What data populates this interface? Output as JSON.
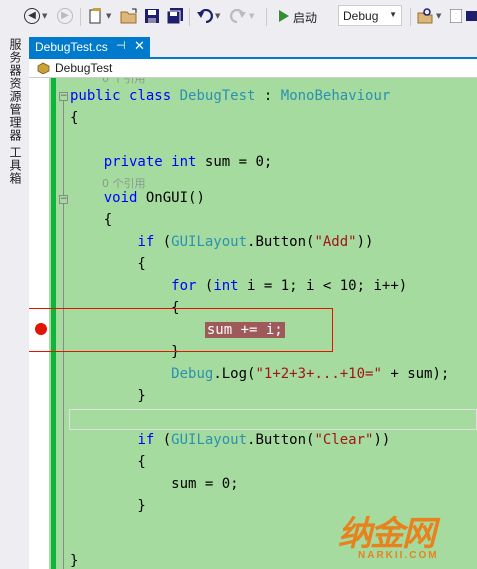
{
  "toolbar": {
    "start_label": "启动",
    "config_value": "Debug"
  },
  "left_strip": {
    "tabs": [
      "服务器资源管理器",
      "工具箱"
    ]
  },
  "document_tab": {
    "title": "DebugTest.cs",
    "pin_glyph": "⊣",
    "close_glyph": "✕"
  },
  "navbar": {
    "class_dropdown": "DebugTest"
  },
  "editor": {
    "codelens_top": "0 个引用",
    "codelens_ongui": "0 个引用",
    "colors": {
      "background": "#a6dba0",
      "change_bar": "#0fb43c",
      "breakpoint": "#e51400",
      "highlight": "#9e5a5a"
    }
  },
  "watermark": {
    "main": "纳金网",
    "sub": "NARKII.COM"
  }
}
